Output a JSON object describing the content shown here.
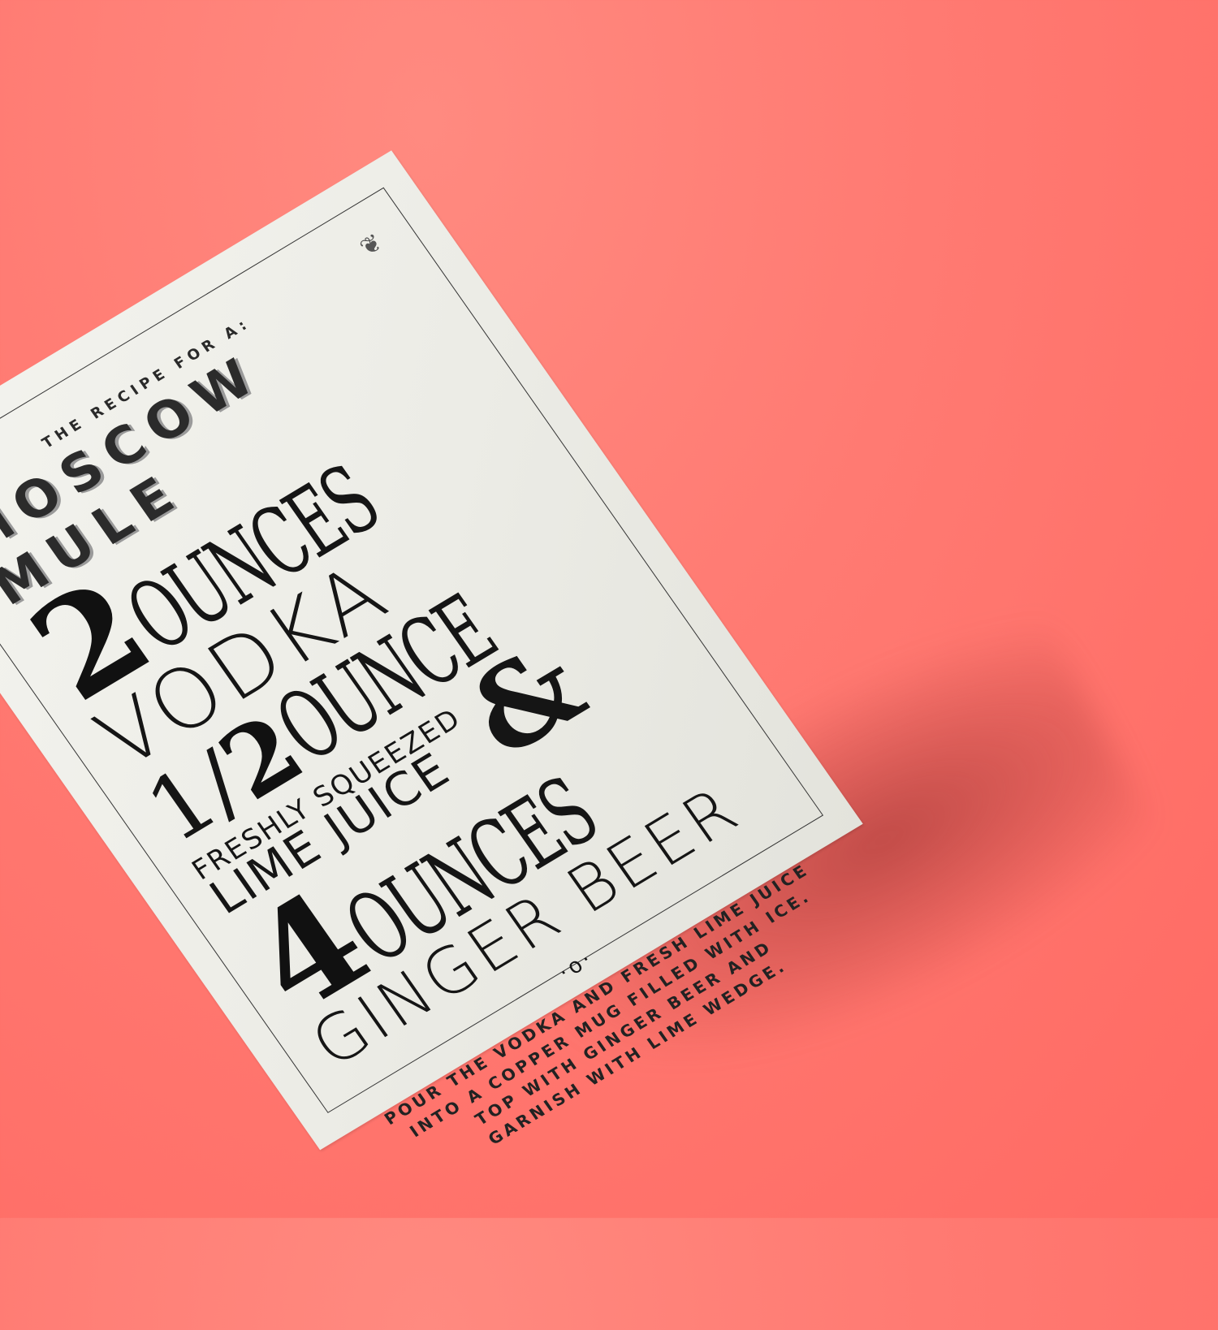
{
  "background": {
    "color": "#ff7a72"
  },
  "poster": {
    "eyebrow": "THE RECIPE FOR A:",
    "title": "MOSCOW MULE",
    "line1": {
      "number": "2",
      "unit": "OUNCES"
    },
    "line2": {
      "ingredient": "VODKA"
    },
    "line3": {
      "numerator": "1",
      "slash": "/",
      "denominator": "2",
      "unit": "OUNCE"
    },
    "line4": {
      "descriptor": "FRESHLY SQUEEZED",
      "ingredient": "LIME JUICE",
      "ampersand": "&"
    },
    "line5": {
      "number": "4",
      "unit": "OUNCES"
    },
    "line6": {
      "ingredient": "GINGER BEER"
    },
    "divider": "·o·",
    "instructions": [
      "POUR THE VODKA AND FRESH LIME JUICE",
      "INTO A COPPER MUG FILLED WITH ICE.",
      "TOP WITH GINGER BEER AND",
      "GARNISH WITH LIME WEDGE."
    ],
    "flourish_left": "❧",
    "flourish_right": "❦"
  }
}
